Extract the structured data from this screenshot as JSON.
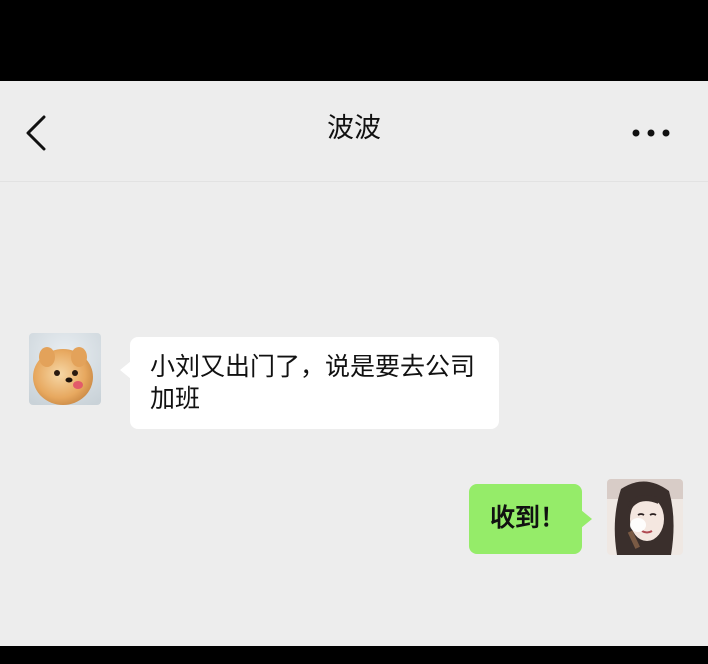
{
  "header": {
    "title": "波波",
    "back_icon": "chevron-left-icon",
    "more_icon": "more-horizontal-icon"
  },
  "messages": [
    {
      "side": "left",
      "sender_avatar": "pomeranian-dog-avatar",
      "text": "小刘又出门了，说是要去公司加班"
    },
    {
      "side": "right",
      "sender_avatar": "woman-sketch-avatar",
      "text": "收到！"
    }
  ],
  "colors": {
    "background": "#ededed",
    "incoming_bubble": "#ffffff",
    "outgoing_bubble": "#95ec69",
    "frame": "#000000"
  }
}
